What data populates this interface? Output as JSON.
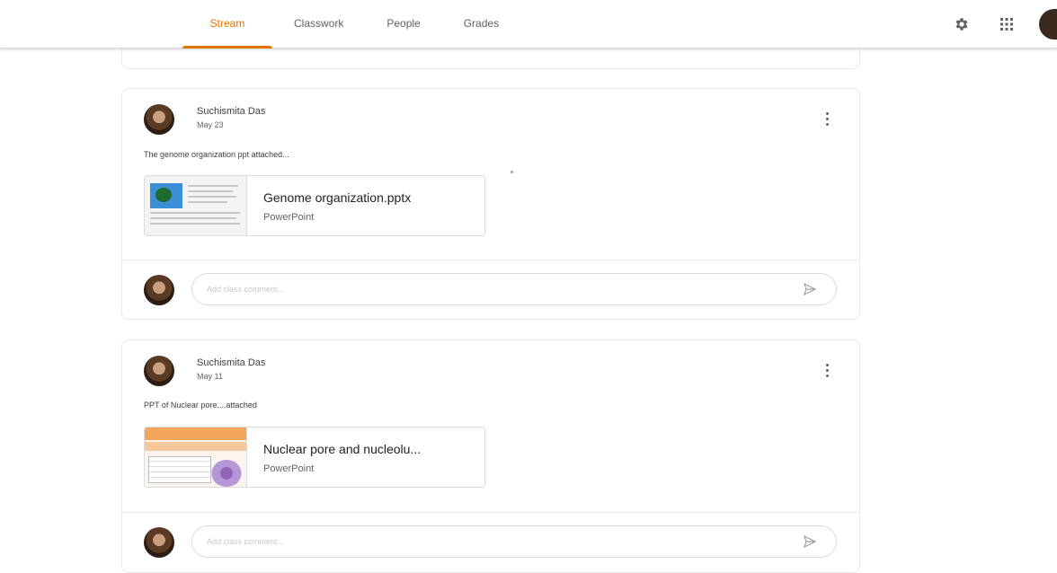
{
  "tabs": [
    {
      "label": "Stream",
      "active": true
    },
    {
      "label": "Classwork",
      "active": false
    },
    {
      "label": "People",
      "active": false
    },
    {
      "label": "Grades",
      "active": false
    }
  ],
  "icons": {
    "settings": "gear-icon",
    "apps": "apps-grid-icon",
    "account": "account-avatar"
  },
  "colors": {
    "accent": "#e37400",
    "divider": "#dadce0"
  },
  "posts": [
    {
      "author": "Suchismita Das",
      "date": "May 23",
      "text": "The genome organization ppt attached...",
      "attachment": {
        "title": "Genome organization.pptx",
        "type": "PowerPoint"
      },
      "comment_placeholder": "Add class comment..."
    },
    {
      "author": "Suchismita Das",
      "date": "May 11",
      "text": "PPT of Nuclear pore....attached",
      "attachment": {
        "title": "Nuclear pore and nucleolu...",
        "type": "PowerPoint"
      },
      "comment_placeholder": "Add class comment..."
    }
  ]
}
